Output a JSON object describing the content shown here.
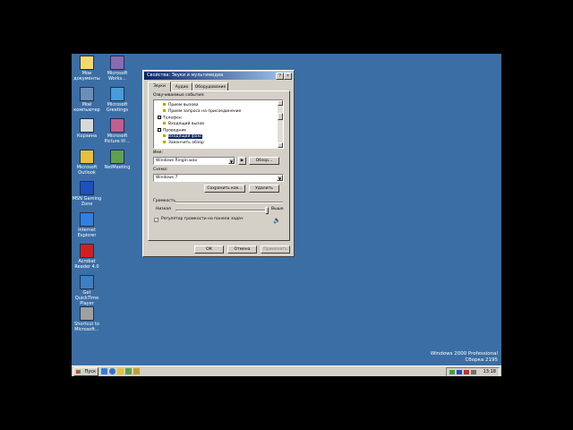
{
  "desktop": {
    "icons": [
      {
        "label": "Мои документы",
        "icon": "folder-icon",
        "color": "#f5d76e"
      },
      {
        "label": "Microsoft Works...",
        "icon": "works-icon",
        "color": "#8b6bb0"
      },
      {
        "label": "Мой компьютер",
        "icon": "computer-icon",
        "color": "#6b8fb8"
      },
      {
        "label": "Microsoft Greetings",
        "icon": "greetings-icon",
        "color": "#4a9cd8"
      },
      {
        "label": "Корзина",
        "icon": "recycle-bin-icon",
        "color": "#d8d8d8"
      },
      {
        "label": "Microsoft Picture It!...",
        "icon": "picture-it-icon",
        "color": "#c06090"
      },
      {
        "label": "Microsoft Outlook",
        "icon": "outlook-icon",
        "color": "#e8c040"
      },
      {
        "label": "NetMeeting",
        "icon": "netmeeting-icon",
        "color": "#60a050"
      },
      {
        "label": "MSN Gaming Zone",
        "icon": "gaming-zone-icon",
        "color": "#2050c0"
      },
      {
        "label": "Internet Explorer",
        "icon": "ie-icon",
        "color": "#3080e0"
      },
      {
        "label": "Acrobat Reader 4.0",
        "icon": "acrobat-icon",
        "color": "#d02020"
      },
      {
        "label": "Get QuickTime Player",
        "icon": "quicktime-icon",
        "color": "#4080c0"
      },
      {
        "label": "Shortcut to Microsoft...",
        "icon": "shortcut-icon",
        "color": "#a0a0a0"
      }
    ],
    "watermark_line1": "Windows 2000 Professional",
    "watermark_line2": "Сборка 2195"
  },
  "taskbar": {
    "start_label": "Пуск",
    "clock": "13:18"
  },
  "dialog": {
    "title": "Свойства: Звуки и мультимедиа",
    "help_btn": "?",
    "close_btn": "×",
    "tabs": [
      "Звуки",
      "Аудио",
      "Оборудование"
    ],
    "events_label": "Озвучиваемые события:",
    "events": [
      {
        "text": "Прием вызова",
        "kind": "sound"
      },
      {
        "text": "Прием запроса на присоединение",
        "kind": "sound"
      },
      {
        "text": "Телефон",
        "kind": "group"
      },
      {
        "text": "Входящий вызов",
        "kind": "sound"
      },
      {
        "text": "Проводник",
        "kind": "group"
      },
      {
        "text": "Входящий факс",
        "kind": "sound",
        "selected": true
      },
      {
        "text": "Закончить обзор",
        "kind": "sound"
      }
    ],
    "name_label": "Имя:",
    "name_value": "Windows Ringin.wav",
    "browse_btn": "Обзор...",
    "scheme_label": "Схема:",
    "scheme_value": "Windows 7",
    "save_as_btn": "Сохранить как...",
    "delete_btn": "Удалить",
    "volume_label": "Громкость",
    "volume_low": "Низкая",
    "volume_high": "Выше",
    "volume_level": 1.0,
    "taskbar_volume_check": "Регулятор громкости на панели задач",
    "ok_btn": "ОК",
    "cancel_btn": "Отмена",
    "apply_btn": "Применить"
  }
}
